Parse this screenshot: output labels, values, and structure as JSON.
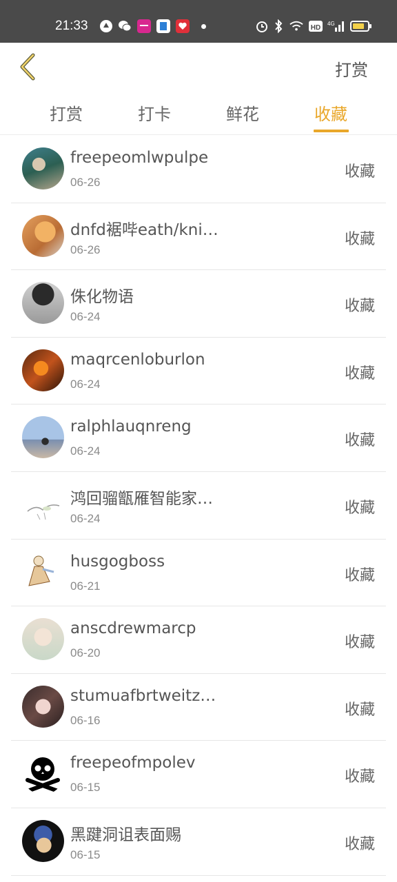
{
  "status_bar": {
    "time": "21:33",
    "network": "4G",
    "hd": "HD"
  },
  "header": {
    "back_icon": "chevron-left-icon",
    "action_label": "打赏"
  },
  "tabs": [
    {
      "label": "打赏"
    },
    {
      "label": "打卡"
    },
    {
      "label": "鲜花"
    },
    {
      "label": "收藏"
    }
  ],
  "active_tab": "收藏",
  "colors": {
    "accent": "#e9a72a",
    "status_bar": "#4a4a4a"
  },
  "list": [
    {
      "name": "freepeomlwpulpe",
      "date": "06-26",
      "action": "收藏"
    },
    {
      "name": "dnfd裾哔eath/kni…",
      "date": "06-26",
      "action": "收藏"
    },
    {
      "name": "侏化物语",
      "date": "06-24",
      "action": "收藏"
    },
    {
      "name": "maqrcenloburlon",
      "date": "06-24",
      "action": "收藏"
    },
    {
      "name": "ralphlauqnreng",
      "date": "06-24",
      "action": "收藏"
    },
    {
      "name": "鸿回骝甑雁智能家…",
      "date": "06-24",
      "action": "收藏"
    },
    {
      "name": "husgogboss",
      "date": "06-21",
      "action": "收藏"
    },
    {
      "name": "anscdrewmarcp",
      "date": "06-20",
      "action": "收藏"
    },
    {
      "name": "stumuafbrtweitz…",
      "date": "06-16",
      "action": "收藏"
    },
    {
      "name": "freepeofmpolev",
      "date": "06-15",
      "action": "收藏"
    },
    {
      "name": "黑踺洞诅表面赐",
      "date": "06-15",
      "action": "收藏"
    }
  ]
}
